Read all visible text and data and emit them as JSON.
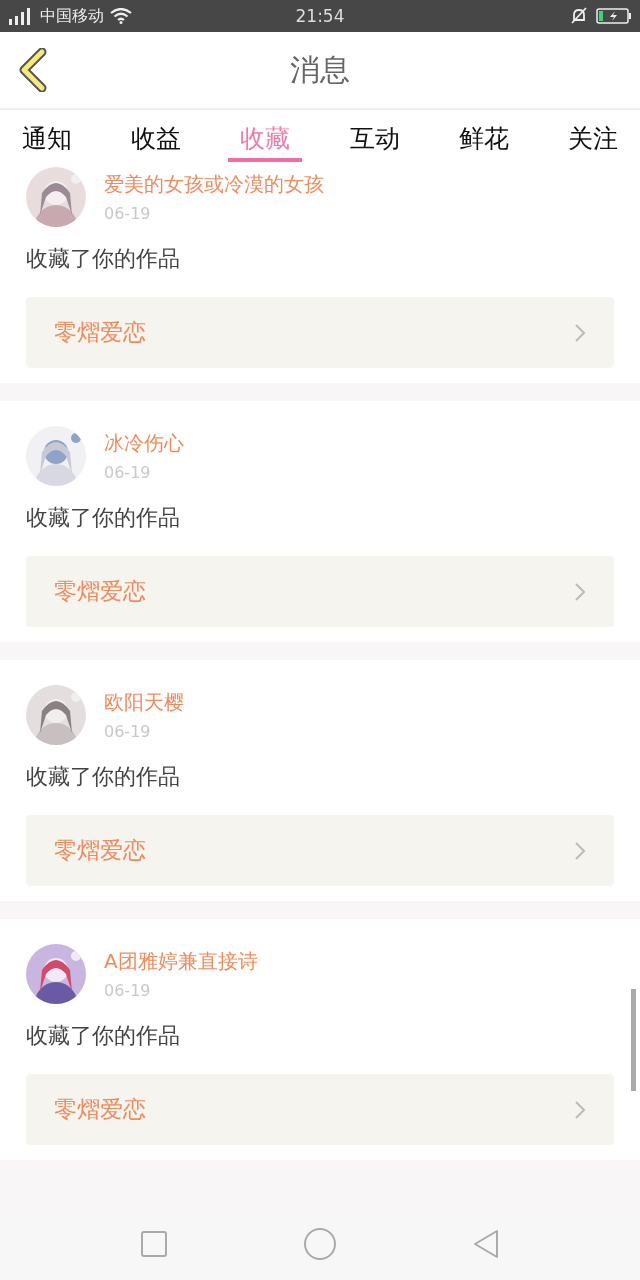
{
  "status_bar": {
    "carrier": "中国移动",
    "time": "21:54"
  },
  "header": {
    "title": "消息"
  },
  "tabs": [
    {
      "label": "通知",
      "selected": false
    },
    {
      "label": "收益",
      "selected": false
    },
    {
      "label": "收藏",
      "selected": true
    },
    {
      "label": "互动",
      "selected": false
    },
    {
      "label": "鲜花",
      "selected": false
    },
    {
      "label": "关注",
      "selected": false
    }
  ],
  "messages": [
    {
      "user": "爱美的女孩或冷漠的女孩",
      "date": "06-19",
      "action": "收藏了你的作品",
      "work": "零熠爱恋"
    },
    {
      "user": "冰冷伤心",
      "date": "06-19",
      "action": "收藏了你的作品",
      "work": "零熠爱恋"
    },
    {
      "user": "欧阳天樱",
      "date": "06-19",
      "action": "收藏了你的作品",
      "work": "零熠爱恋"
    },
    {
      "user": "A团雅婷兼直接诗",
      "date": "06-19",
      "action": "收藏了你的作品",
      "work": "零熠爱恋"
    }
  ]
}
